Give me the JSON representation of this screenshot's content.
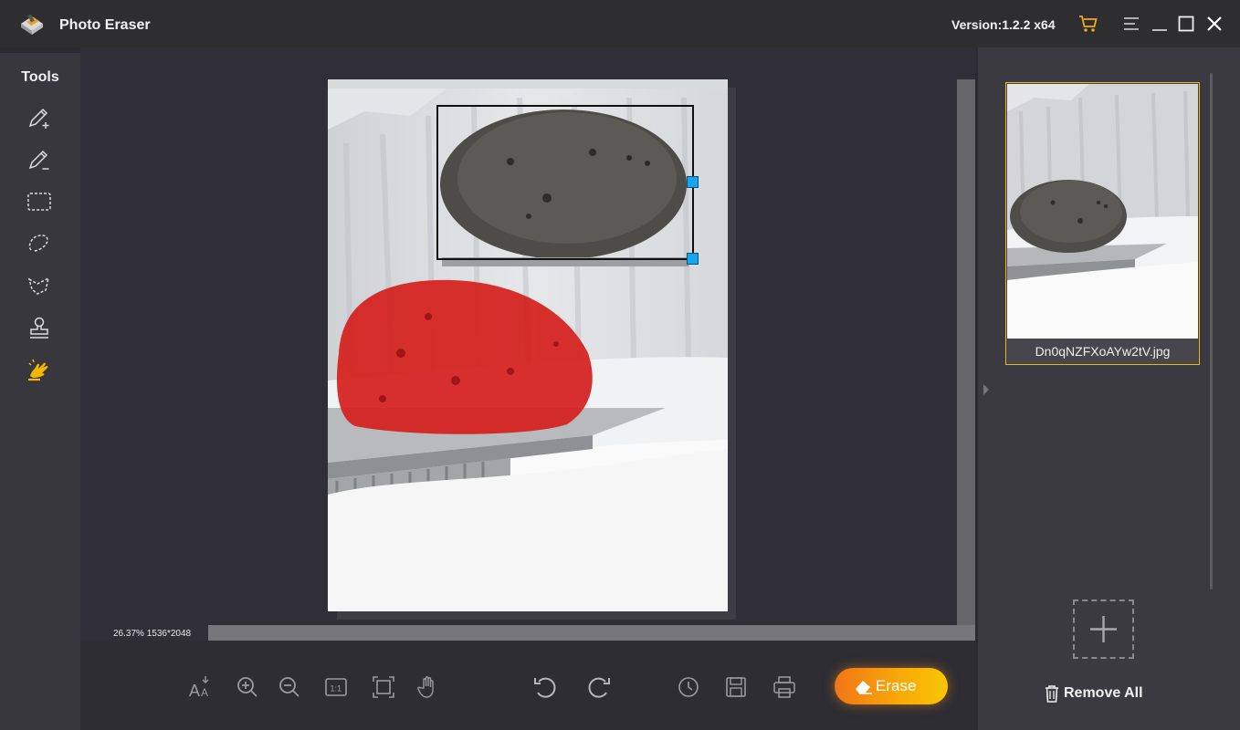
{
  "app": {
    "title": "Photo Eraser",
    "version": "Version:1.2.2 x64"
  },
  "colors": {
    "accent": "#f0b21a",
    "handle": "#16a6f0",
    "cart": "#f5a623",
    "erase_start": "#f07517",
    "erase_end": "#f7c700",
    "mask": "#d4201d"
  },
  "window_controls": [
    "cart-icon",
    "menu-icon",
    "minimize-icon",
    "maximize-icon",
    "close-icon"
  ],
  "tools": {
    "label": "Tools",
    "items": [
      {
        "name": "brush-add",
        "icon": "pencil-plus-icon"
      },
      {
        "name": "brush-remove",
        "icon": "pencil-minus-icon"
      },
      {
        "name": "rectangle-select",
        "icon": "rect-select-icon"
      },
      {
        "name": "lasso",
        "icon": "lasso-icon"
      },
      {
        "name": "polygon-lasso",
        "icon": "polygon-lasso-icon"
      },
      {
        "name": "clone-stamp",
        "icon": "stamp-icon"
      },
      {
        "name": "hand-paint",
        "icon": "hand-brush-icon",
        "active": true
      }
    ]
  },
  "canvas": {
    "zoom_info": "26.37%  1536*2048"
  },
  "bottom_toolbar": {
    "icons": [
      "auto-text-icon",
      "zoom-in-icon",
      "zoom-out-icon",
      "actual-size-icon",
      "fit-screen-icon",
      "hand-pan-icon",
      "undo-icon",
      "redo-icon",
      "history-icon",
      "save-icon",
      "print-icon"
    ],
    "erase_label": "Erase"
  },
  "files": {
    "items": [
      {
        "name": "Dn0qNZFXoAYw2tV.jpg",
        "selected": true
      }
    ],
    "remove_all_label": "Remove All"
  }
}
